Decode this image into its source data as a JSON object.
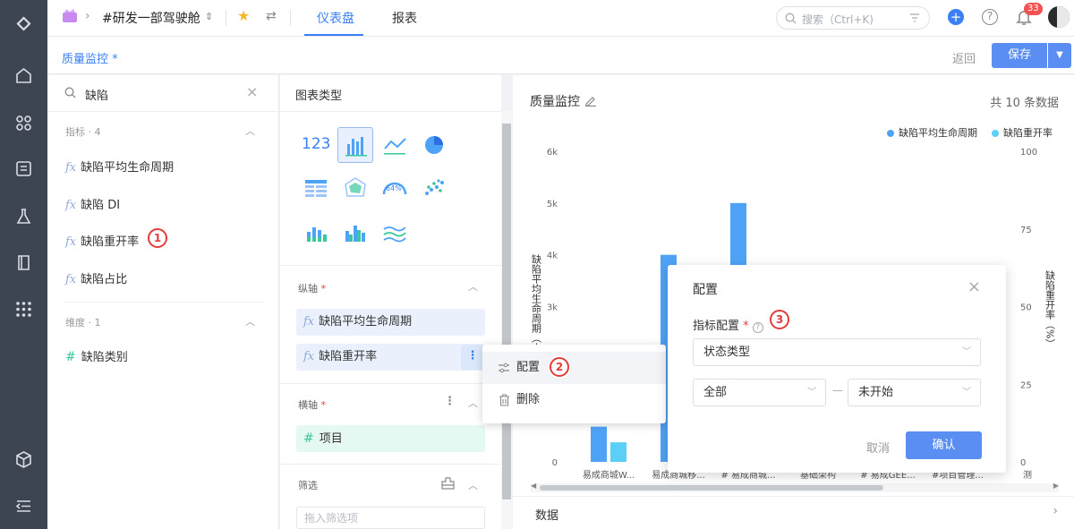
{
  "topbar": {
    "workspace": "#研发一部驾驶舱",
    "tabs": [
      {
        "label": "仪表盘",
        "active": true
      },
      {
        "label": "报表",
        "active": false
      }
    ],
    "search_placeholder": "搜索（Ctrl+K)",
    "notification_count": "33"
  },
  "subheader": {
    "title": "质量监控 *",
    "back_label": "返回",
    "save_label": "保存"
  },
  "field_panel": {
    "search_value": "缺陷",
    "metrics_section": "指标 · 4",
    "metrics": [
      "缺陷平均生命周期",
      "缺陷 DI",
      "缺陷重开率",
      "缺陷占比"
    ],
    "dimensions_section": "维度 · 1",
    "dimensions": [
      "缺陷类别"
    ],
    "marker": "1"
  },
  "chart_config": {
    "header": "图表类型",
    "y_axis_label": "纵轴",
    "y_fields": [
      "缺陷平均生命周期",
      "缺陷重开率"
    ],
    "x_axis_label": "横轴",
    "x_fields": [
      "项目"
    ],
    "filter_label": "筛选",
    "filter_placeholder": "拖入筛选项",
    "number_icon_text": "123",
    "gauge_icon_text": "64%",
    "required_mark": "*"
  },
  "context_menu": {
    "items": [
      "配置",
      "删除"
    ],
    "marker": "2"
  },
  "config_dialog": {
    "title": "配置",
    "metric_label": "指标配置",
    "metric_value": "状态类型",
    "from_value": "全部",
    "separator": "—",
    "to_value": "未开始",
    "cancel_label": "取消",
    "confirm_label": "确认",
    "marker": "3"
  },
  "chart_data": {
    "type": "bar",
    "title": "质量监控",
    "record_count": "共 10 条数据",
    "categories": [
      "易成商城W...",
      "易成商城移...",
      "# 易成商城...",
      "基础架构",
      "# 易成GEE...",
      "#项目管理...",
      "测"
    ],
    "series": [
      {
        "name": "缺陷平均生命周期",
        "color": "#4fa3f7",
        "values": [
          680,
          4000,
          5000,
          null,
          null,
          null,
          null
        ]
      },
      {
        "name": "缺陷重开率",
        "color": "#5ccff6",
        "values": [
          6.3,
          null,
          null,
          null,
          null,
          null,
          null
        ]
      }
    ],
    "y_left": {
      "label": "缺陷平均生命周期（小",
      "ticks": [
        "0",
        "1k",
        "2k",
        "3k",
        "4k",
        "5k",
        "6k"
      ],
      "range": [
        0,
        6000
      ]
    },
    "y_right": {
      "label": "缺陷重开率（%）",
      "ticks": [
        "0",
        "25",
        "50",
        "75",
        "100"
      ],
      "range": [
        0,
        100
      ]
    },
    "legend_position": "top-right",
    "data_section_label": "数据"
  }
}
